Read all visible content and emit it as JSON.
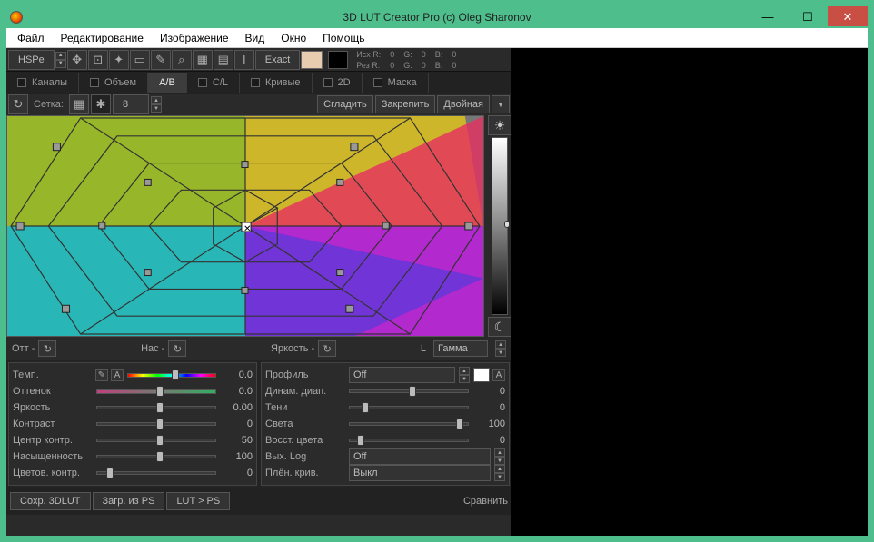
{
  "window": {
    "title": "3D LUT Creator Pro (c) Oleg Sharonov"
  },
  "menu": [
    "Файл",
    "Редактирование",
    "Изображение",
    "Вид",
    "Окно",
    "Помощь"
  ],
  "toolbar": {
    "mode": "HSPe",
    "exact": "Exact",
    "rgb_src_label": "Исх R:",
    "rgb_res_label": "Рез R:",
    "rgb": {
      "r1": "0",
      "g1": "0",
      "b1": "0",
      "r2": "0",
      "g2": "0",
      "b2": "0"
    }
  },
  "tabs": [
    "Каналы",
    "Объем",
    "A/B",
    "C/L",
    "Кривые",
    "2D",
    "Маска"
  ],
  "active_tab": 2,
  "gridctrl": {
    "reset_tooltip": "reset",
    "grid_label": "Сетка:",
    "grid_size": "8",
    "smooth": "Сгладить",
    "pin": "Закрепить",
    "double": "Двойная"
  },
  "adjust": {
    "hue": "Отт -",
    "sat": "Нас -",
    "brightness": "Яркость -",
    "L": "L",
    "gamma": "Гамма"
  },
  "params_left": [
    {
      "label": "Темп.",
      "value": "0.0",
      "pos": 50,
      "style": "rainbow",
      "picker": true
    },
    {
      "label": "Оттенок",
      "value": "0.0",
      "pos": 50,
      "style": "green"
    },
    {
      "label": "Яркость",
      "value": "0.00",
      "pos": 50
    },
    {
      "label": "Контраст",
      "value": "0",
      "pos": 50
    },
    {
      "label": "Центр контр.",
      "value": "50",
      "pos": 50
    },
    {
      "label": "Насыщенность",
      "value": "100",
      "pos": 50
    },
    {
      "label": "Цветов. контр.",
      "value": "0",
      "pos": 8
    }
  ],
  "params_right": {
    "profile_label": "Профиль",
    "profile_value": "Off",
    "A_label": "A",
    "rows": [
      {
        "label": "Динам. диап.",
        "value": "0",
        "pos": 50
      },
      {
        "label": "Тени",
        "value": "0",
        "pos": 10
      },
      {
        "label": "Света",
        "value": "100",
        "pos": 90
      },
      {
        "label": "Восст. цвета",
        "value": "0",
        "pos": 6
      }
    ],
    "log_label": "Вых. Log",
    "log_value": "Off",
    "film_label": "Плён. крив.",
    "film_value": "Выкл"
  },
  "actions": {
    "save3dlut": "Сохр. 3DLUT",
    "loadps": "Загр. из PS",
    "lut2ps": "LUT > PS",
    "compare": "Сравнить"
  }
}
